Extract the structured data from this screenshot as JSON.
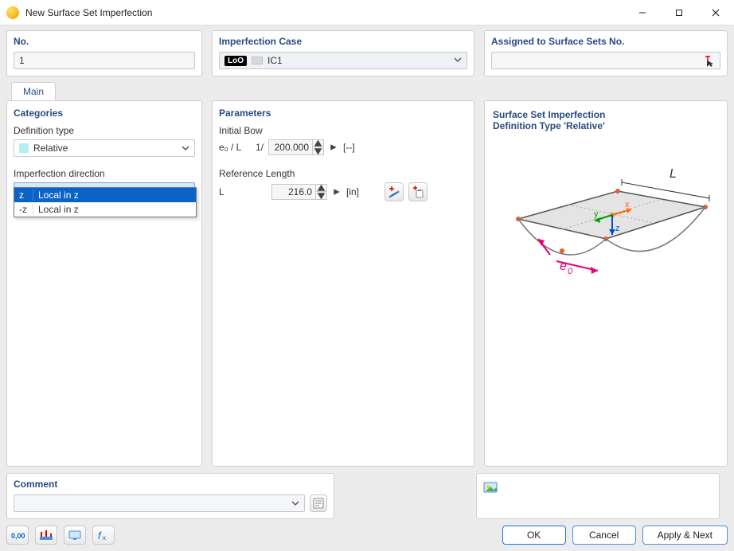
{
  "window": {
    "title": "New Surface Set Imperfection"
  },
  "top": {
    "no": {
      "title": "No.",
      "value": "1"
    },
    "case": {
      "title": "Imperfection Case",
      "badge": "LoO",
      "value": "IC1"
    },
    "assign": {
      "title": "Assigned to Surface Sets No.",
      "value": ""
    }
  },
  "tabs": {
    "main": "Main"
  },
  "categories": {
    "title": "Categories",
    "definition_type": {
      "label": "Definition type",
      "value": "Relative"
    },
    "direction": {
      "label": "Imperfection direction",
      "value": "z",
      "options": [
        {
          "key": "z",
          "label": "Local in z"
        },
        {
          "key": "-z",
          "label": "Local in z"
        }
      ]
    }
  },
  "parameters": {
    "title": "Parameters",
    "initial_bow": {
      "label": "Initial Bow",
      "symbol": "e₀ / L",
      "prefix": "1/",
      "value": "200.000",
      "unit": "[--]"
    },
    "reference_length": {
      "label": "Reference Length",
      "symbol": "L",
      "value": "216.0",
      "unit": "[in]"
    }
  },
  "rightpanel": {
    "line1": "Surface Set Imperfection",
    "line2": "Definition Type 'Relative'",
    "diagram": {
      "L": "L",
      "e0": "e",
      "e0_sub": "0",
      "x": "x",
      "y": "y",
      "z": "z"
    }
  },
  "comment": {
    "title": "Comment"
  },
  "footer": {
    "ok": "OK",
    "cancel": "Cancel",
    "apply_next": "Apply & Next"
  }
}
